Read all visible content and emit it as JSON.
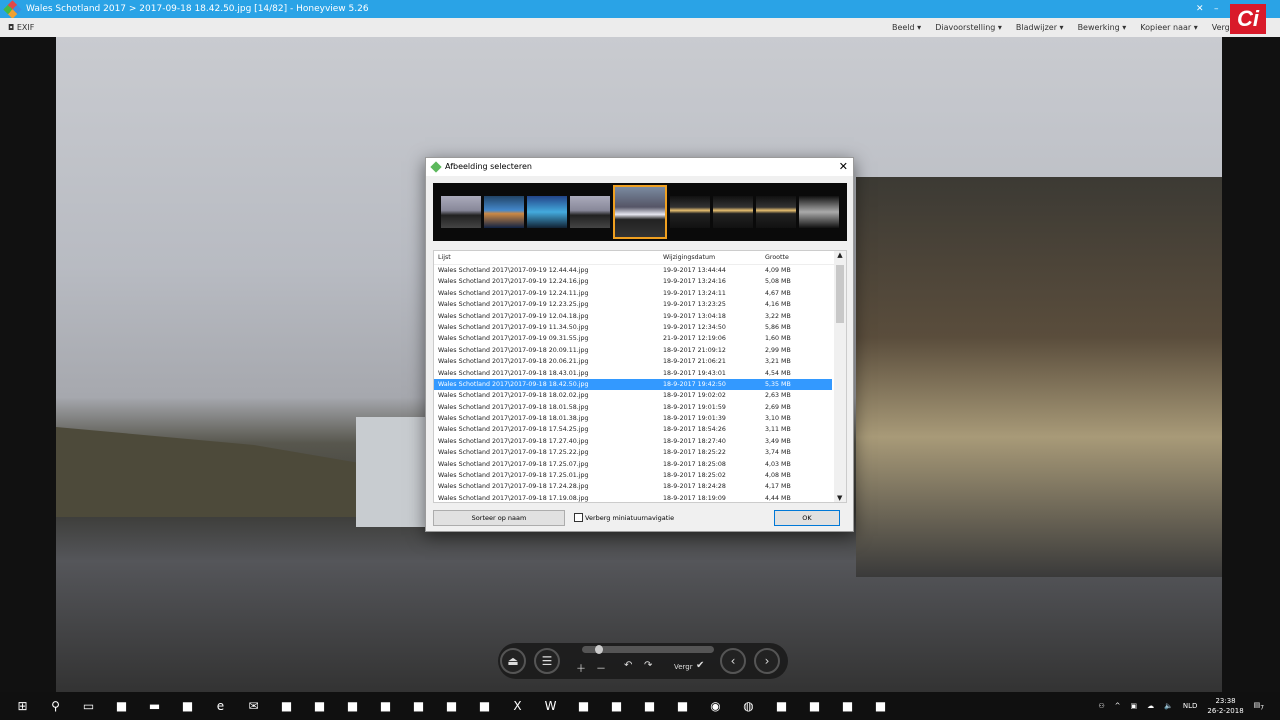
{
  "window": {
    "title": "Wales Schotland 2017 > 2017-09-18 18.42.50.jpg [14/82] - Honeyview 5.26"
  },
  "toolbar": {
    "exif": "EXIF",
    "menus": [
      "Beeld",
      "Diavoorstelling",
      "Bladwijzer",
      "Bewerking",
      "Kopieer naar",
      "Vergr"
    ]
  },
  "watermark": "Ci",
  "dialog": {
    "title": "Afbeelding selecteren",
    "columns": {
      "name": "Lijst",
      "date": "Wijzigingsdatum",
      "size": "Grootte"
    },
    "selected_index": 10,
    "rows": [
      [
        "Wales Schotland 2017\\2017-09-19 12.44.44.jpg",
        "19-9-2017 13:44:44",
        "4,09 MB"
      ],
      [
        "Wales Schotland 2017\\2017-09-19 12.24.16.jpg",
        "19-9-2017 13:24:16",
        "5,08 MB"
      ],
      [
        "Wales Schotland 2017\\2017-09-19 12.24.11.jpg",
        "19-9-2017 13:24:11",
        "4,67 MB"
      ],
      [
        "Wales Schotland 2017\\2017-09-19 12.23.25.jpg",
        "19-9-2017 13:23:25",
        "4,16 MB"
      ],
      [
        "Wales Schotland 2017\\2017-09-19 12.04.18.jpg",
        "19-9-2017 13:04:18",
        "3,22 MB"
      ],
      [
        "Wales Schotland 2017\\2017-09-19 11.34.50.jpg",
        "19-9-2017 12:34:50",
        "5,86 MB"
      ],
      [
        "Wales Schotland 2017\\2017-09-19 09.31.55.jpg",
        "21-9-2017 12:19:06",
        "1,60 MB"
      ],
      [
        "Wales Schotland 2017\\2017-09-18 20.09.11.jpg",
        "18-9-2017 21:09:12",
        "2,99 MB"
      ],
      [
        "Wales Schotland 2017\\2017-09-18 20.06.21.jpg",
        "18-9-2017 21:06:21",
        "3,21 MB"
      ],
      [
        "Wales Schotland 2017\\2017-09-18 18.43.01.jpg",
        "18-9-2017 19:43:01",
        "4,54 MB"
      ],
      [
        "Wales Schotland 2017\\2017-09-18 18.42.50.jpg",
        "18-9-2017 19:42:50",
        "5,35 MB"
      ],
      [
        "Wales Schotland 2017\\2017-09-18 18.02.02.jpg",
        "18-9-2017 19:02:02",
        "2,63 MB"
      ],
      [
        "Wales Schotland 2017\\2017-09-18 18.01.58.jpg",
        "18-9-2017 19:01:59",
        "2,69 MB"
      ],
      [
        "Wales Schotland 2017\\2017-09-18 18.01.38.jpg",
        "18-9-2017 19:01:39",
        "3,10 MB"
      ],
      [
        "Wales Schotland 2017\\2017-09-18 17.54.25.jpg",
        "18-9-2017 18:54:26",
        "3,11 MB"
      ],
      [
        "Wales Schotland 2017\\2017-09-18 17.27.40.jpg",
        "18-9-2017 18:27:40",
        "3,49 MB"
      ],
      [
        "Wales Schotland 2017\\2017-09-18 17.25.22.jpg",
        "18-9-2017 18:25:22",
        "3,74 MB"
      ],
      [
        "Wales Schotland 2017\\2017-09-18 17.25.07.jpg",
        "18-9-2017 18:25:08",
        "4,03 MB"
      ],
      [
        "Wales Schotland 2017\\2017-09-18 17.25.01.jpg",
        "18-9-2017 18:25:02",
        "4,08 MB"
      ],
      [
        "Wales Schotland 2017\\2017-09-18 17.24.28.jpg",
        "18-9-2017 18:24:28",
        "4,17 MB"
      ],
      [
        "Wales Schotland 2017\\2017-09-18 17.19.08.jpg",
        "18-9-2017 18:19:09",
        "4,44 MB"
      ]
    ],
    "sort_button": "Sorteer op naam",
    "hide_thumbs_label": "Verberg miniatuurnavigatie",
    "hide_thumbs_checked": false,
    "ok_button": "OK"
  },
  "controls": {
    "zoom_label": "Vergr",
    "slider_fraction": 0.1
  },
  "taskbar": {
    "icons": [
      "start-icon",
      "search-icon",
      "task-view-icon",
      "file-explorer-icon",
      "folder-icon",
      "file-icon",
      "edge-icon",
      "mail-icon",
      "camtasia-icon",
      "camtasia-recorder-icon",
      "notepad-icon",
      "feather-icon",
      "browser-icon",
      "acrobat-icon",
      "green-app-icon",
      "excel-icon",
      "word-icon",
      "pdf-icon",
      "remote-desktop-icon",
      "internet-explorer-icon",
      "outlook-icon",
      "chrome-icon",
      "firefox-icon",
      "app-icon",
      "globe-icon",
      "camera-icon",
      "honeyview-icon"
    ],
    "lang": "NLD",
    "time": "23:38",
    "date": "26-2-2018",
    "notifications": "7"
  }
}
